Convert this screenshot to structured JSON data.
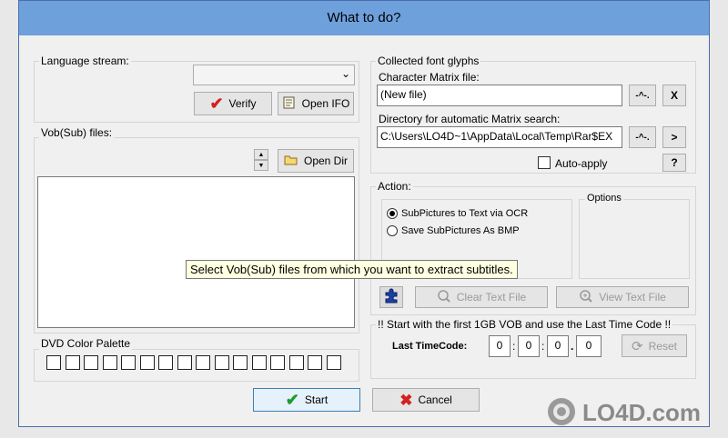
{
  "window": {
    "title": "What to do?"
  },
  "language": {
    "group_label": "Language stream:",
    "select_value": "",
    "verify_label": "Verify",
    "open_ifo_label": "Open IFO"
  },
  "vobsub": {
    "group_label": "Vob(Sub) files:",
    "open_dir_label": "Open Dir"
  },
  "palette": {
    "group_label": "DVD Color Palette",
    "swatch_count": 16
  },
  "fonts": {
    "group_label": "Collected font glyphs",
    "matrix_label": "Character Matrix file:",
    "matrix_value": "(New file)",
    "matrix_btn": "-^-.",
    "clear_btn": "X",
    "dir_label": "Directory for automatic Matrix search:",
    "dir_value": "C:\\Users\\LO4D~1\\AppData\\Local\\Temp\\Rar$EX",
    "dir_btn": "-^-.",
    "go_btn": ">",
    "auto_apply_label": "Auto-apply",
    "help_btn": "?"
  },
  "action": {
    "group_label": "Action:",
    "options_label": "Options",
    "radio1": "SubPictures to Text via OCR",
    "radio2": "Save SubPictures As BMP",
    "clear_text_label": "Clear Text File",
    "view_text_label": "View Text File"
  },
  "timecode": {
    "group_label": "!! Start with the first 1GB VOB and use the Last Time Code !!",
    "last_label": "Last TimeCode:",
    "h": "0",
    "m": "0",
    "s": "0",
    "f": "0",
    "sep1": ":",
    "sep2": ":",
    "sep3": ".",
    "reset_label": "Reset"
  },
  "footer": {
    "start_label": "Start",
    "cancel_label": "Cancel"
  },
  "tooltip": {
    "text": "Select Vob(Sub) files from which you want to extract subtitles."
  },
  "watermark": {
    "text": "LO4D.com"
  }
}
